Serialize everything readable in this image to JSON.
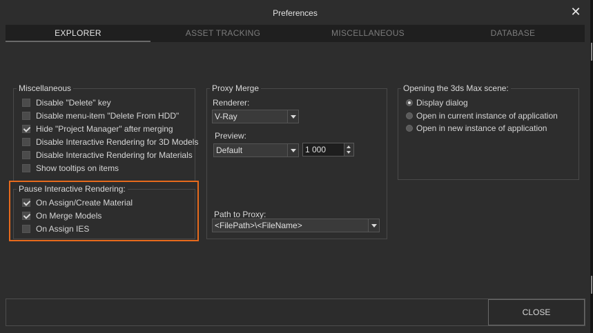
{
  "window": {
    "title": "Preferences",
    "close_icon": "close-icon"
  },
  "tabs": [
    {
      "label": "EXPLORER",
      "active": true
    },
    {
      "label": "ASSET TRACKING",
      "active": false
    },
    {
      "label": "MISCELLANEOUS",
      "active": false
    },
    {
      "label": "DATABASE",
      "active": false
    }
  ],
  "misc_group": {
    "legend": "Miscellaneous",
    "items": [
      {
        "label": "Disable \"Delete\" key",
        "checked": false
      },
      {
        "label": "Disable menu-item \"Delete From HDD\"",
        "checked": false
      },
      {
        "label": "Hide \"Project Manager\" after merging",
        "checked": true
      },
      {
        "label": "Disable Interactive Rendering for 3D Models",
        "checked": false
      },
      {
        "label": "Disable Interactive Rendering for Materials",
        "checked": false
      },
      {
        "label": "Show tooltips on items",
        "checked": false
      }
    ]
  },
  "pause_group": {
    "legend": "Pause Interactive Rendering:",
    "items": [
      {
        "label": "On Assign/Create Material",
        "checked": true
      },
      {
        "label": "On Merge Models",
        "checked": true
      },
      {
        "label": "On Assign IES",
        "checked": false
      }
    ],
    "highlight_color": "#e86a1c"
  },
  "proxy_group": {
    "legend": "Proxy Merge",
    "renderer_label": "Renderer:",
    "renderer_value": "V-Ray",
    "preview_label": "Preview:",
    "preview_value": "Default",
    "preview_count": "1 000",
    "path_label": "Path to Proxy:",
    "path_value": "<FilePath>\\<FileName>"
  },
  "scene_group": {
    "legend": "Opening the 3ds Max scene:",
    "options": [
      {
        "label": "Display dialog",
        "selected": true
      },
      {
        "label": "Open in current instance of application",
        "selected": false
      },
      {
        "label": "Open in new instance of application",
        "selected": false
      }
    ]
  },
  "footer": {
    "close_label": "CLOSE"
  }
}
